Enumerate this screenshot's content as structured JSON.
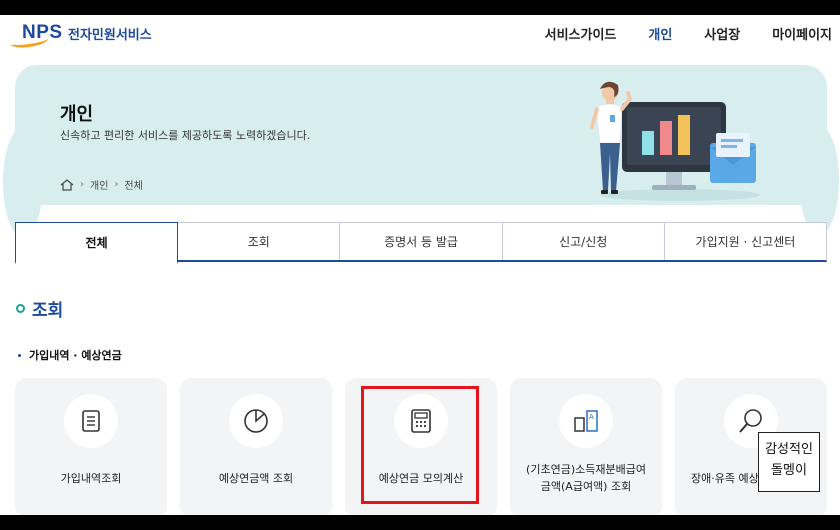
{
  "header": {
    "logo_en": "NPS",
    "logo_ko": "전자민원서비스",
    "nav": [
      {
        "label": "서비스가이드",
        "active": false
      },
      {
        "label": "개인",
        "active": true
      },
      {
        "label": "사업장",
        "active": false
      },
      {
        "label": "마이페이지",
        "active": false
      }
    ]
  },
  "banner": {
    "title": "개인",
    "subtitle": "신속하고 편리한 서비스를 제공하도록 노력하겠습니다.",
    "breadcrumb": [
      "개인",
      "전체"
    ]
  },
  "tabs": [
    {
      "label": "전체",
      "active": true
    },
    {
      "label": "조회",
      "active": false
    },
    {
      "label": "증명서 등 발급",
      "active": false
    },
    {
      "label": "신고/신청",
      "active": false
    },
    {
      "label": "가입지원 · 신고센터",
      "active": false
    }
  ],
  "section": {
    "title": "조회",
    "subtitle": "가입내역 · 예상연금"
  },
  "cards": [
    {
      "icon": "document-icon",
      "line1": "가입내역조회",
      "line2": ""
    },
    {
      "icon": "pie-chart-icon",
      "line1": "예상연금액 조회",
      "line2": ""
    },
    {
      "icon": "calculator-icon",
      "line1": "예상연금 모의계산",
      "line2": ""
    },
    {
      "icon": "document-split-icon",
      "line1": "(기초연금)소득재분배급여",
      "line2": "금액(A급여액) 조회"
    },
    {
      "icon": "magnifier-icon",
      "line1": "장애·유족 예상",
      "line2": ""
    }
  ],
  "sticker": {
    "line1": "감성적인",
    "line2": "돌멩이"
  },
  "colors": {
    "brand": "#1d4a9c",
    "banner": "#d8eeee",
    "accent_teal": "#19a0a0",
    "highlight": "#e8141c",
    "logo_orange": "#f7a21b"
  }
}
